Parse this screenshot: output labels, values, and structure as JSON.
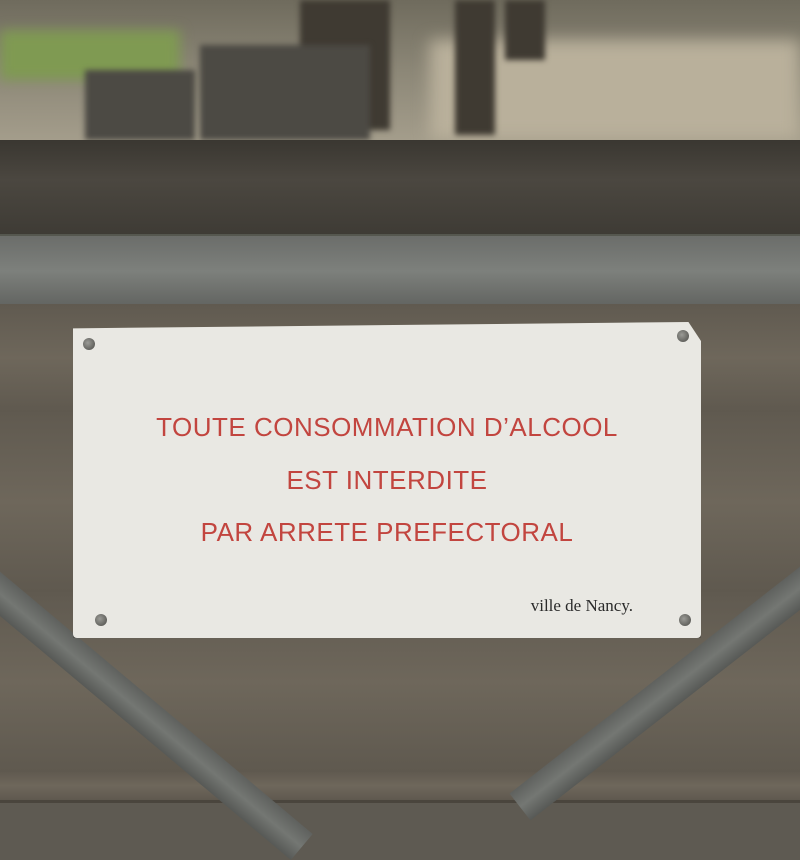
{
  "sign": {
    "line1": "TOUTE CONSOMMATION D’ALCOOL",
    "line2": "EST INTERDITE",
    "line3": "PAR ARRETE PREFECTORAL",
    "signature": "ville de Nancy."
  },
  "colors": {
    "sign_text": "#c2453f",
    "sign_background": "#e9e8e3"
  }
}
